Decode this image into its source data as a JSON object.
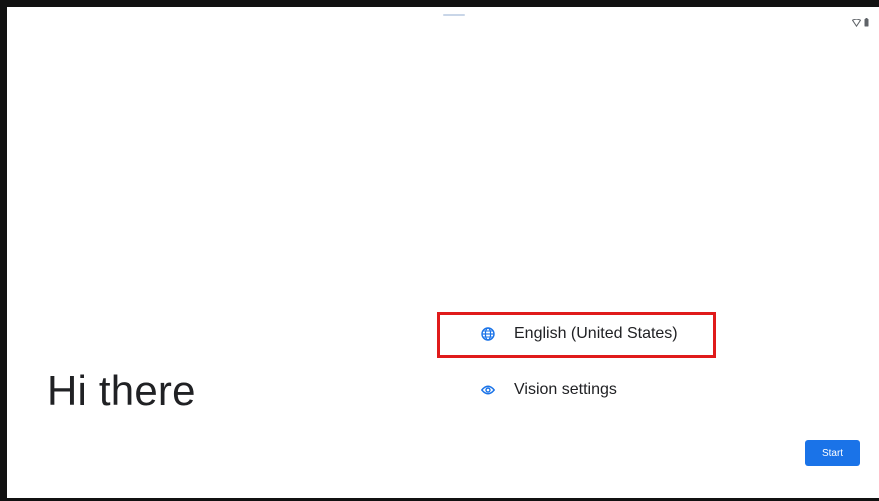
{
  "welcome": {
    "greeting": "Hi there",
    "language_option": {
      "label": "English (United States)",
      "icon": "globe-icon"
    },
    "vision_option": {
      "label": "Vision settings",
      "icon": "eye-icon"
    },
    "start_label": "Start"
  },
  "status_bar": {
    "icons": [
      "wifi-icon",
      "battery-icon"
    ]
  },
  "colors": {
    "accent": "#1a73e8",
    "highlight": "#e01b1b",
    "text": "#202124",
    "background": "#ffffff"
  }
}
